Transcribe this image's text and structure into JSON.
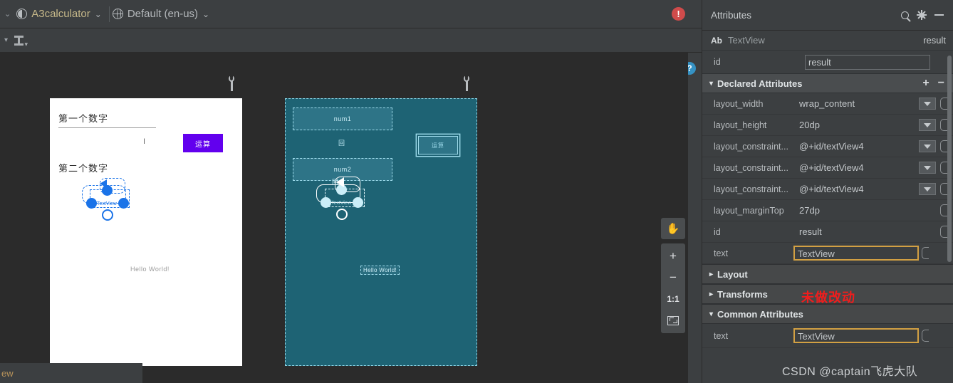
{
  "toolbar": {
    "module_label": "A3calculator",
    "locale_label": "Default (en-us)",
    "module_icon": "theme-circle-icon",
    "locale_icon": "globe-icon",
    "caret": "⌄",
    "chevron_left": "⌄",
    "second_row_icon": "baseline-align-icon",
    "error_badge": "!",
    "help_badge": "?"
  },
  "canvas": {
    "design": {
      "label_first": "第一个数字",
      "caret_text": "I",
      "label_second": "第二个数字",
      "button_label": "运算",
      "hello_text": "Hello World!",
      "selected_text": "TextView"
    },
    "blueprint": {
      "field_one": "num1",
      "divider_text": "回",
      "field_two": "num2",
      "button_label": "运算",
      "hello_text": "Hello World!",
      "selected_text": "TextView",
      "selected_tag": "回"
    },
    "wrench_icon": "wrench-icon"
  },
  "zoom_controls": {
    "pan_icon": "✋",
    "zoom_in": "+",
    "zoom_out": "−",
    "actual_size": "1:1",
    "fit_icon": "fit-to-screen-icon"
  },
  "status_bar": {
    "text": "ew"
  },
  "attributes": {
    "title": "Attributes",
    "search_icon": "search-icon",
    "gear_icon": "gear-icon",
    "minimize_icon": "minimize-icon",
    "component_marker": "Ab",
    "component_type": "TextView",
    "component_id": "result",
    "id_row": {
      "key": "id",
      "value": "result"
    },
    "declared": {
      "header": "Declared Attributes",
      "add_icon": "+",
      "remove_icon": "−",
      "rows": [
        {
          "key": "layout_width",
          "value": "wrap_content",
          "dropdown": true
        },
        {
          "key": "layout_height",
          "value": "20dp",
          "dropdown": true
        },
        {
          "key": "layout_constraint...",
          "value": "@+id/textView4",
          "dropdown": true
        },
        {
          "key": "layout_constraint...",
          "value": "@+id/textView4",
          "dropdown": true
        },
        {
          "key": "layout_constraint...",
          "value": "@+id/textView4",
          "dropdown": true
        },
        {
          "key": "layout_marginTop",
          "value": "27dp",
          "dropdown": false
        },
        {
          "key": "id",
          "value": "result",
          "dropdown": false
        },
        {
          "key": "text",
          "value": "TextView",
          "dropdown": false,
          "highlight": true
        }
      ]
    },
    "sections": [
      {
        "label": "Layout",
        "expanded": false
      },
      {
        "label": "Transforms",
        "expanded": false
      },
      {
        "label": "Common Attributes",
        "expanded": true
      }
    ],
    "common_rows": [
      {
        "key": "text",
        "value": "TextView",
        "highlight": true
      }
    ]
  },
  "annotations": {
    "red_note": "未做改动",
    "watermark": "CSDN @captain飞虎大队"
  },
  "colors": {
    "panel_bg": "#3c3f41",
    "canvas_bg": "#2b2b2b",
    "blueprint_bg": "#1e6374",
    "blueprint_line": "#9fdcec",
    "accent_purple": "#6200ee",
    "highlight_border": "#d2a043",
    "error_red": "#cf4b4b",
    "help_blue": "#3592c4",
    "annot_red": "#f01d1d"
  }
}
